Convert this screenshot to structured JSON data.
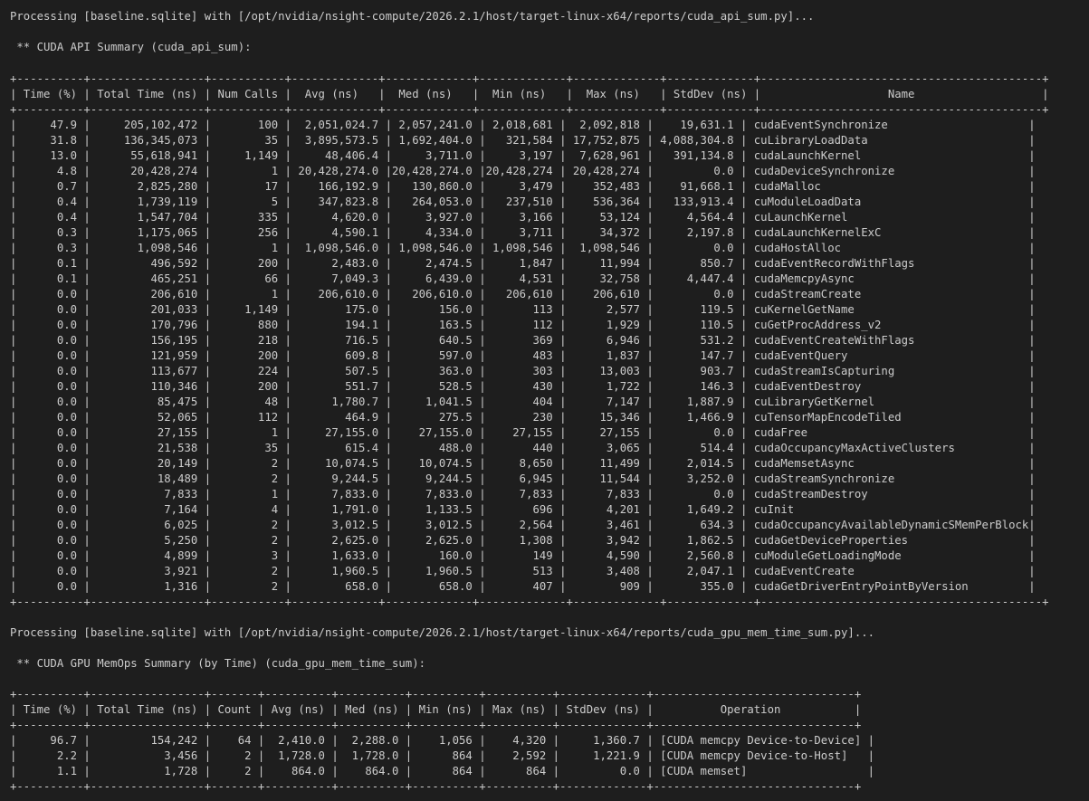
{
  "api_header": {
    "processing": "Processing [baseline.sqlite] with [/opt/nvidia/nsight-compute/2026.2.1/host/target-linux-x64/reports/cuda_api_sum.py]...",
    "title": " ** CUDA API Summary (cuda_api_sum):"
  },
  "api_table": {
    "border": "+----------+-----------------+-----------+-------------+-------------+-------------+-------------+-------------+------------------------------------------+",
    "header": "| Time (%) | Total Time (ns) | Num Calls |  Avg (ns)   |  Med (ns)   |  Min (ns)   |  Max (ns)   | StdDev (ns) |                   Name                   |",
    "rows": [
      "|     47.9 |     205,102,472 |       100 |  2,051,024.7 | 2,057,241.0 | 2,018,681 |  2,092,818 |    19,631.1 | cudaEventSynchronize                     |",
      "|     31.8 |     136,345,073 |        35 |  3,895,573.5 | 1,692,404.0 |   321,584 | 17,752,875 | 4,088,304.8 | cuLibraryLoadData                        |",
      "|     13.0 |      55,618,941 |     1,149 |     48,406.4 |     3,711.0 |     3,197 |  7,628,961 |   391,134.8 | cudaLaunchKernel                         |",
      "|      4.8 |      20,428,274 |         1 | 20,428,274.0 |20,428,274.0 |20,428,274 | 20,428,274 |         0.0 | cudaDeviceSynchronize                    |",
      "|      0.7 |       2,825,280 |        17 |    166,192.9 |   130,860.0 |     3,479 |    352,483 |    91,668.1 | cudaMalloc                               |",
      "|      0.4 |       1,739,119 |         5 |    347,823.8 |   264,053.0 |   237,510 |    536,364 |   133,913.4 | cuModuleLoadData                         |",
      "|      0.4 |       1,547,704 |       335 |      4,620.0 |     3,927.0 |     3,166 |     53,124 |     4,564.4 | cuLaunchKernel                           |",
      "|      0.3 |       1,175,065 |       256 |      4,590.1 |     4,334.0 |     3,711 |     34,372 |     2,197.8 | cudaLaunchKernelExC                      |",
      "|      0.3 |       1,098,546 |         1 |  1,098,546.0 | 1,098,546.0 | 1,098,546 |  1,098,546 |         0.0 | cudaHostAlloc                            |",
      "|      0.1 |         496,592 |       200 |      2,483.0 |     2,474.5 |     1,847 |     11,994 |       850.7 | cudaEventRecordWithFlags                 |",
      "|      0.1 |         465,251 |        66 |      7,049.3 |     6,439.0 |     4,531 |     32,758 |     4,447.4 | cudaMemcpyAsync                          |",
      "|      0.0 |         206,610 |         1 |    206,610.0 |   206,610.0 |   206,610 |    206,610 |         0.0 | cudaStreamCreate                         |",
      "|      0.0 |         201,033 |     1,149 |        175.0 |       156.0 |       113 |      2,577 |       119.5 | cuKernelGetName                          |",
      "|      0.0 |         170,796 |       880 |        194.1 |       163.5 |       112 |      1,929 |       110.5 | cuGetProcAddress_v2                      |",
      "|      0.0 |         156,195 |       218 |        716.5 |       640.5 |       369 |      6,946 |       531.2 | cudaEventCreateWithFlags                 |",
      "|      0.0 |         121,959 |       200 |        609.8 |       597.0 |       483 |      1,837 |       147.7 | cudaEventQuery                           |",
      "|      0.0 |         113,677 |       224 |        507.5 |       363.0 |       303 |     13,003 |       903.7 | cudaStreamIsCapturing                    |",
      "|      0.0 |         110,346 |       200 |        551.7 |       528.5 |       430 |      1,722 |       146.3 | cudaEventDestroy                         |",
      "|      0.0 |          85,475 |        48 |      1,780.7 |     1,041.5 |       404 |      7,147 |     1,887.9 | cuLibraryGetKernel                       |",
      "|      0.0 |          52,065 |       112 |        464.9 |       275.5 |       230 |     15,346 |     1,466.9 | cuTensorMapEncodeTiled                   |",
      "|      0.0 |          27,155 |         1 |     27,155.0 |    27,155.0 |    27,155 |     27,155 |         0.0 | cudaFree                                 |",
      "|      0.0 |          21,538 |        35 |        615.4 |       488.0 |       440 |      3,065 |       514.4 | cudaOccupancyMaxActiveClusters           |",
      "|      0.0 |          20,149 |         2 |     10,074.5 |    10,074.5 |     8,650 |     11,499 |     2,014.5 | cudaMemsetAsync                          |",
      "|      0.0 |          18,489 |         2 |      9,244.5 |     9,244.5 |     6,945 |     11,544 |     3,252.0 | cudaStreamSynchronize                    |",
      "|      0.0 |           7,833 |         1 |      7,833.0 |     7,833.0 |     7,833 |      7,833 |         0.0 | cudaStreamDestroy                        |",
      "|      0.0 |           7,164 |         4 |      1,791.0 |     1,133.5 |       696 |      4,201 |     1,649.2 | cuInit                                   |",
      "|      0.0 |           6,025 |         2 |      3,012.5 |     3,012.5 |     2,564 |      3,461 |       634.3 | cudaOccupancyAvailableDynamicSMemPerBlock|",
      "|      0.0 |           5,250 |         2 |      2,625.0 |     2,625.0 |     1,308 |      3,942 |     1,862.5 | cudaGetDeviceProperties                  |",
      "|      0.0 |           4,899 |         3 |      1,633.0 |       160.0 |       149 |      4,590 |     2,560.8 | cuModuleGetLoadingMode                   |",
      "|      0.0 |           3,921 |         2 |      1,960.5 |     1,960.5 |       513 |      3,408 |     2,047.1 | cudaEventCreate                          |",
      "|      0.0 |           1,316 |         2 |        658.0 |       658.0 |       407 |        909 |       355.0 | cudaGetDriverEntryPointByVersion         |"
    ]
  },
  "mem_header": {
    "processing": "Processing [baseline.sqlite] with [/opt/nvidia/nsight-compute/2026.2.1/host/target-linux-x64/reports/cuda_gpu_mem_time_sum.py]...",
    "title": " ** CUDA GPU MemOps Summary (by Time) (cuda_gpu_mem_time_sum):"
  },
  "mem_table": {
    "border": "+----------+-----------------+-------+----------+----------+----------+----------+-------------+------------------------------+",
    "header": "| Time (%) | Total Time (ns) | Count | Avg (ns) | Med (ns) | Min (ns) | Max (ns) | StdDev (ns) |          Operation           |",
    "rows": [
      "|     96.7 |         154,242 |    64 |  2,410.0 |  2,288.0 |    1,056 |    4,320 |     1,360.7 | [CUDA memcpy Device-to-Device] |",
      "|      2.2 |           3,456 |     2 |  1,728.0 |  1,728.0 |      864 |    2,592 |     1,221.9 | [CUDA memcpy Device-to-Host]   |",
      "|      1.1 |           1,728 |     2 |    864.0 |    864.0 |      864 |      864 |         0.0 | [CUDA memset]                  |"
    ]
  }
}
